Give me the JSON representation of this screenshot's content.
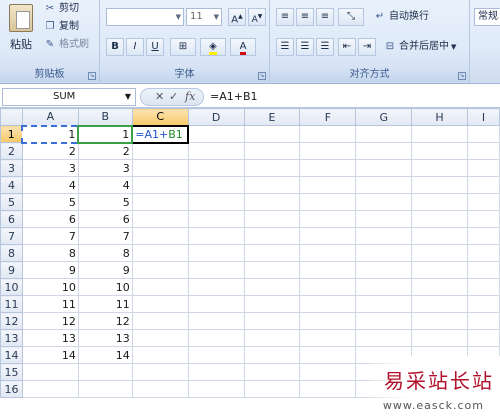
{
  "ribbon": {
    "clipboard": {
      "paste_label": "粘贴",
      "cut_label": "剪切",
      "copy_label": "复制",
      "format_painter_label": "格式刷",
      "group_label": "剪贴板"
    },
    "font": {
      "font_name": "",
      "font_size": "11",
      "bold": "B",
      "italic": "I",
      "underline": "U",
      "group_label": "字体"
    },
    "alignment": {
      "wrap_text_label": "自动换行",
      "merge_center_label": "合并后居中",
      "group_label": "对齐方式"
    },
    "number": {
      "format_label": "常规"
    }
  },
  "formula_bar": {
    "name_box": "SUM",
    "cancel_symbol": "✕",
    "enter_symbol": "✓",
    "fx_symbol": "fx",
    "formula": "=A1+B1"
  },
  "sheet": {
    "columns": [
      "A",
      "B",
      "C",
      "D",
      "E",
      "F",
      "G",
      "H",
      "I"
    ],
    "rows": [
      {
        "n": "1",
        "a": "1",
        "b": "1"
      },
      {
        "n": "2",
        "a": "2",
        "b": "2"
      },
      {
        "n": "3",
        "a": "3",
        "b": "3"
      },
      {
        "n": "4",
        "a": "4",
        "b": "4"
      },
      {
        "n": "5",
        "a": "5",
        "b": "5"
      },
      {
        "n": "6",
        "a": "6",
        "b": "6"
      },
      {
        "n": "7",
        "a": "7",
        "b": "7"
      },
      {
        "n": "8",
        "a": "8",
        "b": "8"
      },
      {
        "n": "9",
        "a": "9",
        "b": "9"
      },
      {
        "n": "10",
        "a": "10",
        "b": "10"
      },
      {
        "n": "11",
        "a": "11",
        "b": "11"
      },
      {
        "n": "12",
        "a": "12",
        "b": "12"
      },
      {
        "n": "13",
        "a": "13",
        "b": "13"
      },
      {
        "n": "14",
        "a": "14",
        "b": "14"
      },
      {
        "n": "15",
        "a": "",
        "b": ""
      },
      {
        "n": "16",
        "a": "",
        "b": ""
      }
    ],
    "editing_cell": {
      "ref1": "=A1",
      "plus": "+",
      "ref2": "B1"
    }
  },
  "watermark": {
    "title": "易采站长站",
    "url": "www.easck.com"
  }
}
